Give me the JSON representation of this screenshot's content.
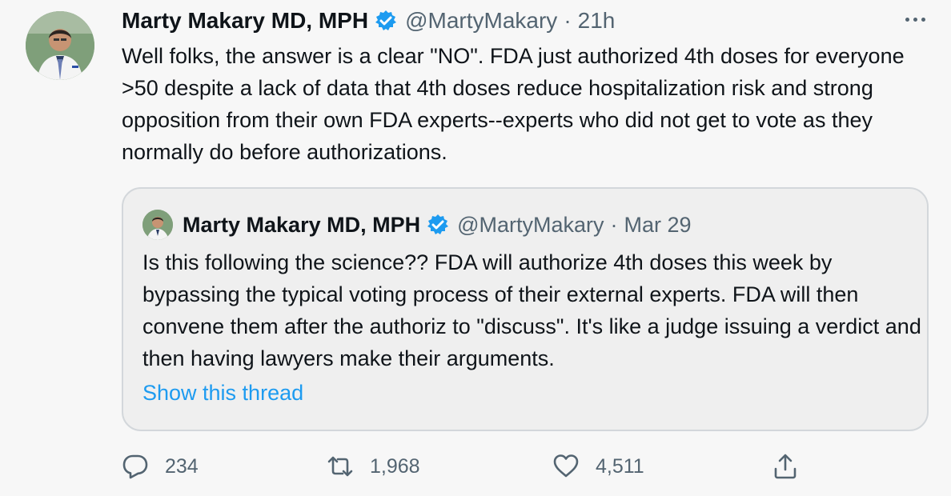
{
  "tweet": {
    "display_name": "Marty Makary MD, MPH",
    "handle": "@MartyMakary",
    "separator": "·",
    "time": "21h",
    "text": "Well folks, the answer is a clear \"NO\".  FDA just authorized 4th doses for everyone >50 despite a lack of data that 4th doses reduce hospitalization risk and strong opposition from their own FDA experts--experts who did not get to vote as they normally do before authorizations.",
    "more_icon": "more-horizontal-icon"
  },
  "quote": {
    "display_name": "Marty Makary MD, MPH",
    "handle": "@MartyMakary",
    "separator": "·",
    "time": "Mar 29",
    "text": "Is this following the science?? FDA will authorize 4th doses this week by bypassing the typical voting process of their external experts. FDA will then convene them after the authoriz to \"discuss\". It's like a judge issuing a verdict and then having lawyers make their arguments.",
    "show_thread": "Show this thread"
  },
  "actions": {
    "reply": {
      "icon": "reply-icon",
      "count": "234"
    },
    "retweet": {
      "icon": "retweet-icon",
      "count": "1,968"
    },
    "like": {
      "icon": "heart-icon",
      "count": "4,511"
    },
    "share": {
      "icon": "share-icon"
    }
  },
  "colors": {
    "background": "#f7f7f7",
    "text": "#0f1419",
    "muted": "#536471",
    "accent": "#1d9bf0",
    "border": "#d3d7db",
    "quote_background": "#efefef"
  }
}
